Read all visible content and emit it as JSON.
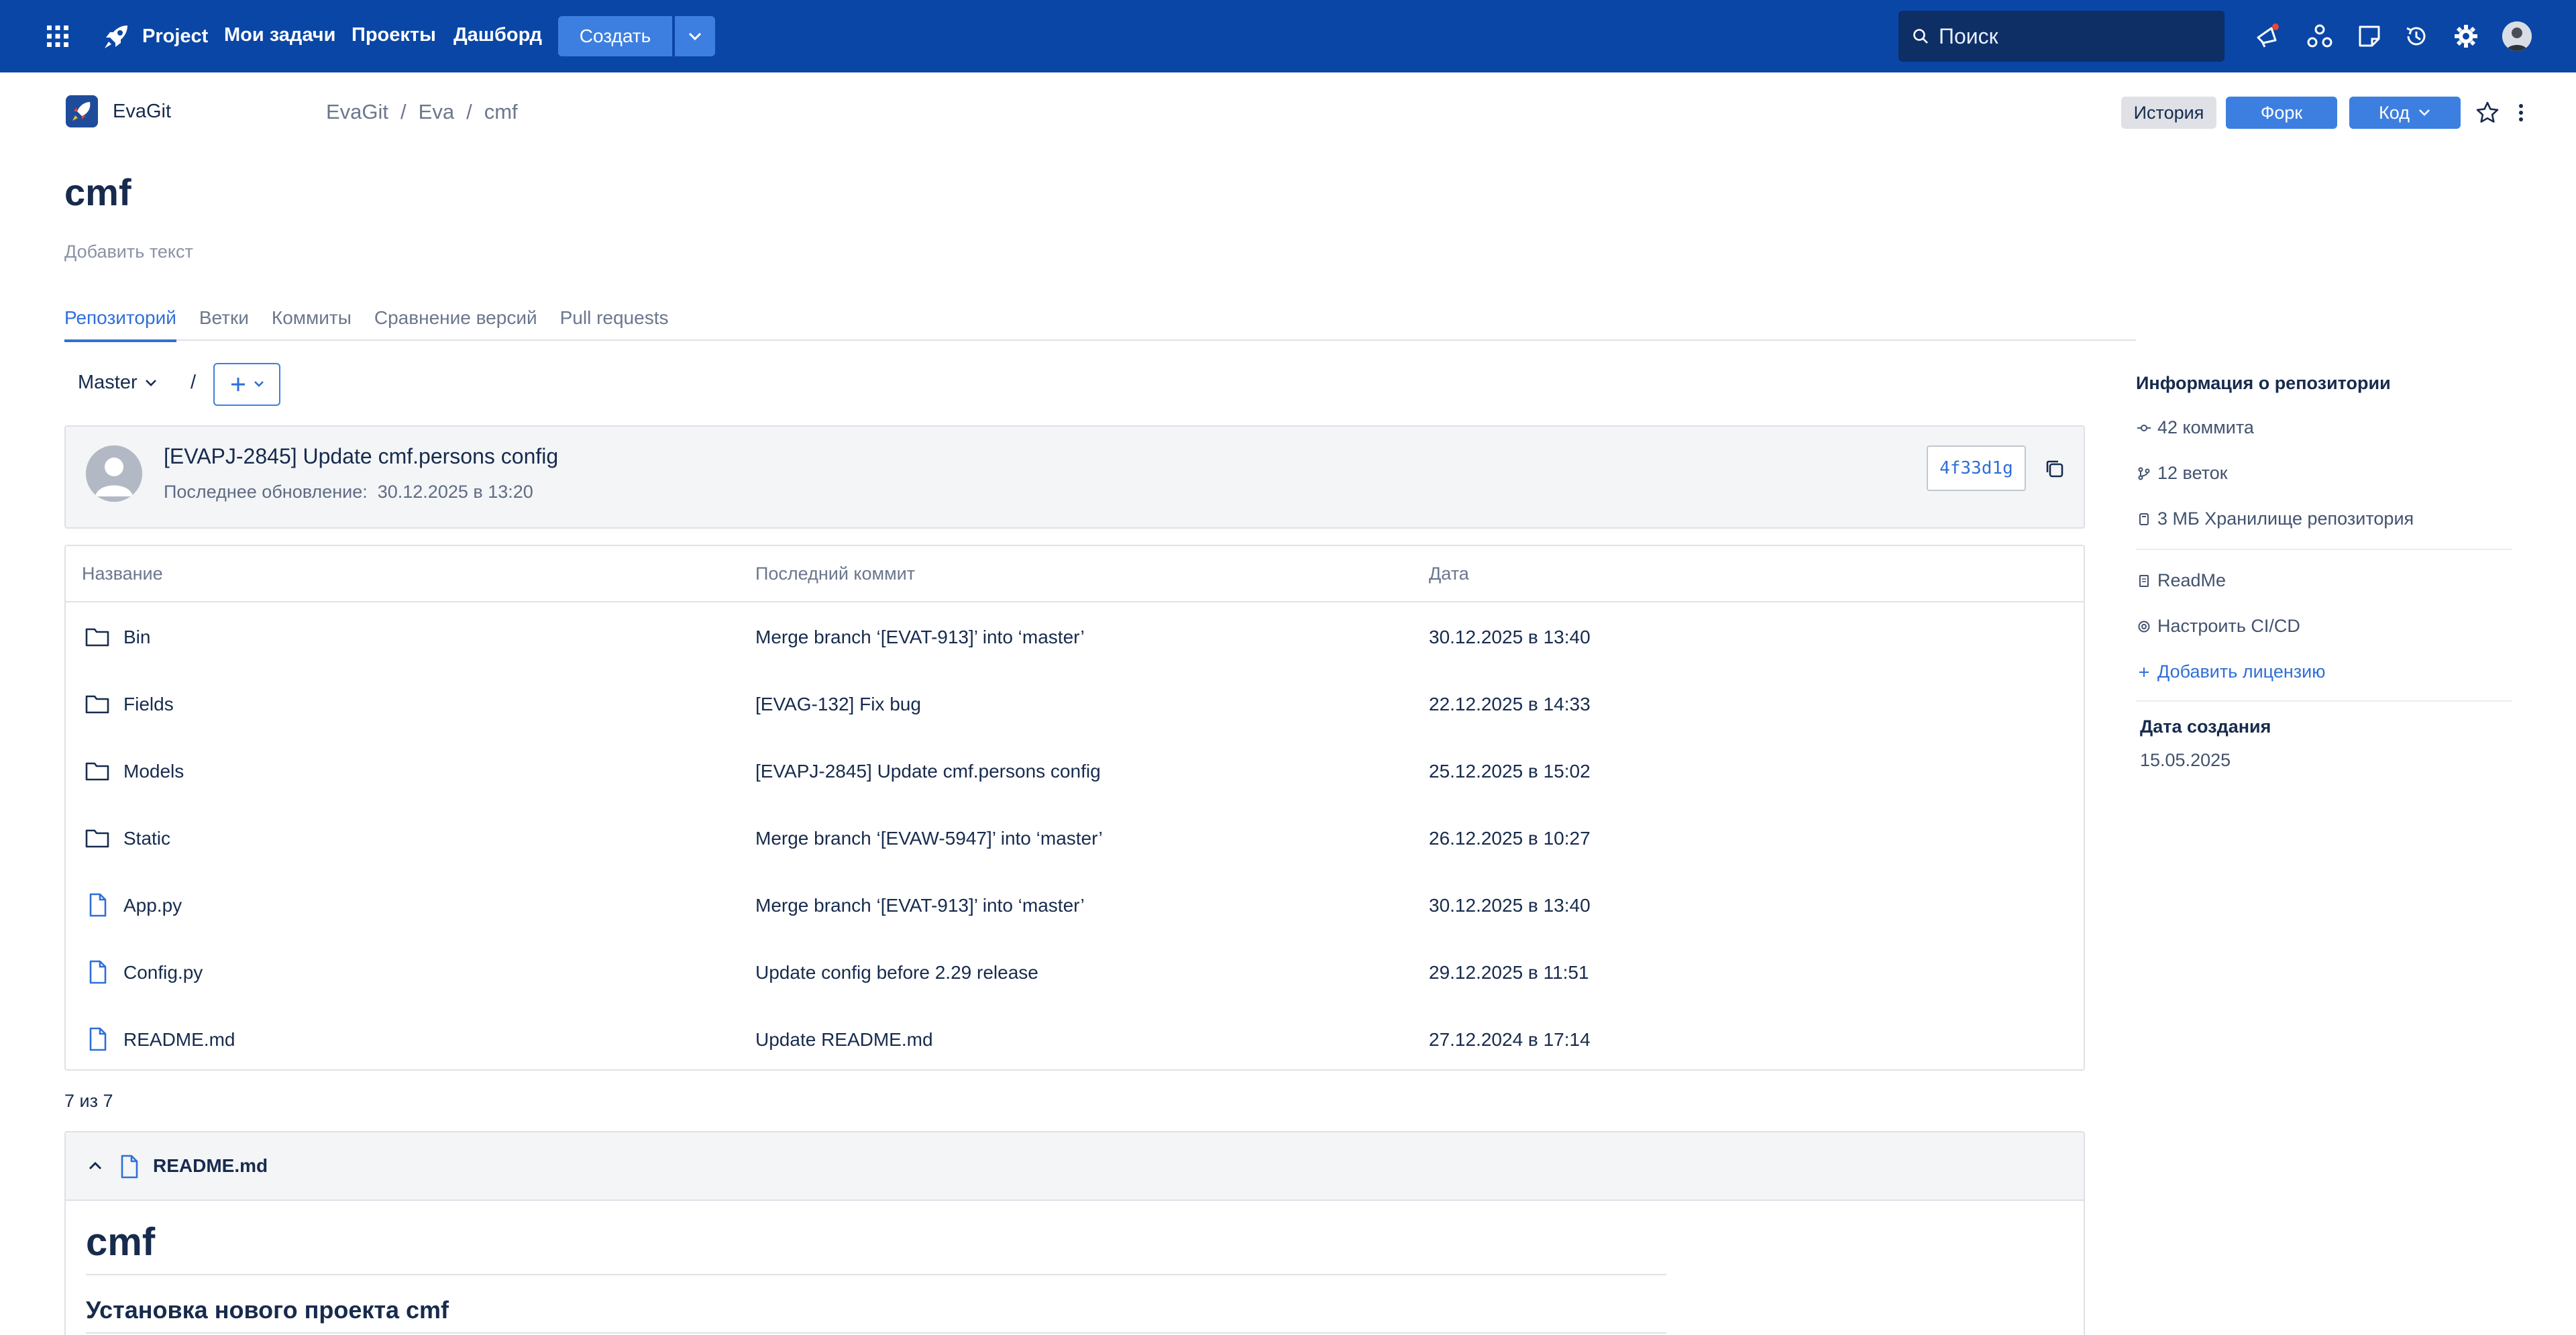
{
  "topbar": {
    "product": "Project",
    "nav": [
      "Мои задачи",
      "Проекты",
      "Дашборд"
    ],
    "create_label": "Создать",
    "search_placeholder": "Поиск",
    "colors": {
      "bar": "#0a46a6",
      "accent": "#3d7fe0"
    }
  },
  "header": {
    "app_name": "EvaGit",
    "breadcrumb": [
      "EvaGit",
      "Eva",
      "cmf"
    ],
    "history_label": "История",
    "fork_label": "Форк",
    "code_label": "Код"
  },
  "repo": {
    "title": "cmf",
    "description_placeholder": "Добавить текст"
  },
  "tabs": [
    "Репозиторий",
    "Ветки",
    "Коммиты",
    "Сравнение версий",
    "Pull requests"
  ],
  "branch": {
    "name": "Master",
    "path_sep": "/"
  },
  "last_commit": {
    "message": "[EVAPJ-2845] Update cmf.persons config",
    "updated_label": "Последнее обновление:",
    "updated_value": "30.12.2025 в 13:20",
    "hash": "4f33d1g"
  },
  "table": {
    "headers": [
      "Название",
      "Последний коммит",
      "Дата"
    ],
    "rows": [
      {
        "type": "folder",
        "name": "Bin",
        "commit": "Merge branch ‘[EVAT-913]’ into ‘master’",
        "date": "30.12.2025 в 13:40"
      },
      {
        "type": "folder",
        "name": "Fields",
        "commit": "[EVAG-132] Fix bug",
        "date": "22.12.2025 в 14:33"
      },
      {
        "type": "folder",
        "name": "Models",
        "commit": "[EVAPJ-2845] Update cmf.persons config",
        "date": "25.12.2025 в 15:02"
      },
      {
        "type": "folder",
        "name": "Static",
        "commit": "Merge branch ‘[EVAW-5947]’ into ‘master’",
        "date": "26.12.2025 в 10:27"
      },
      {
        "type": "file",
        "name": "App.py",
        "commit": "Merge branch ‘[EVAT-913]’ into ‘master’",
        "date": "30.12.2025 в 13:40"
      },
      {
        "type": "file",
        "name": "Config.py",
        "commit": "Update config before 2.29 release",
        "date": "29.12.2025 в 11:51"
      },
      {
        "type": "file",
        "name": "README.md",
        "commit": "Update README.md",
        "date": "27.12.2024 в 17:14"
      }
    ],
    "counter": "7 из 7"
  },
  "readme": {
    "file_name": "README.md",
    "h1": "cmf",
    "h2": "Установка нового проекта cmf"
  },
  "sidebar": {
    "title": "Информация о репозитории",
    "commits": "42 коммита",
    "branches": "12 веток",
    "storage": "3 МБ Хранилище репозитория",
    "readme": "ReadMe",
    "cicd": "Настроить CI/CD",
    "license": "Добавить лицензию",
    "created_label": "Дата создания",
    "created_value": "15.05.2025"
  }
}
